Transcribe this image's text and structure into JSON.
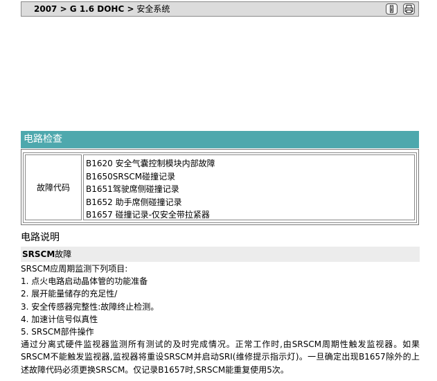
{
  "breadcrumb": {
    "path_bold": "2007 > G 1.6 DOHC >",
    "current": " 安全系统"
  },
  "toolbar": {
    "info_icon": "info-icon",
    "print_icon": "printer-icon"
  },
  "section": {
    "title": "电路检查",
    "header_color": "#4ea8ad"
  },
  "dtc": {
    "label": "故障代码",
    "codes": [
      "B1620 安全气囊控制模块内部故障",
      "B1650SRSCM碰撞记录",
      "B1651驾驶席侧碰撞记录",
      "B1652 助手席侧碰撞记录",
      "B1657 碰撞记录-仅安全带拉紧器"
    ]
  },
  "circuit": {
    "heading": "电路说明",
    "sub_bold": "SRSCM",
    "sub_rest": "故障",
    "lines": [
      "SRSCM应周期监测下列项目:",
      "1. 点火电路启动晶体管的功能准备",
      "2. 展开能量储存的充足性/",
      "3. 安全传感器完整性:故障终止检测。",
      "4. 加速计信号似真性",
      "5. SRSCM部件操作"
    ],
    "paragraph": "通过分离式硬件监视器监测所有测试的及时完成情况。正常工作时,由SRSCM周期性触发监视器。如果SRSCM不能触发监视器,监视器将重设SRSCM并启动SRI(维修提示指示灯)。一旦确定出现B1657除外的上述故障代码必须更换SRSCM。仅记录B1657时,SRSCM能重复使用5次。"
  }
}
